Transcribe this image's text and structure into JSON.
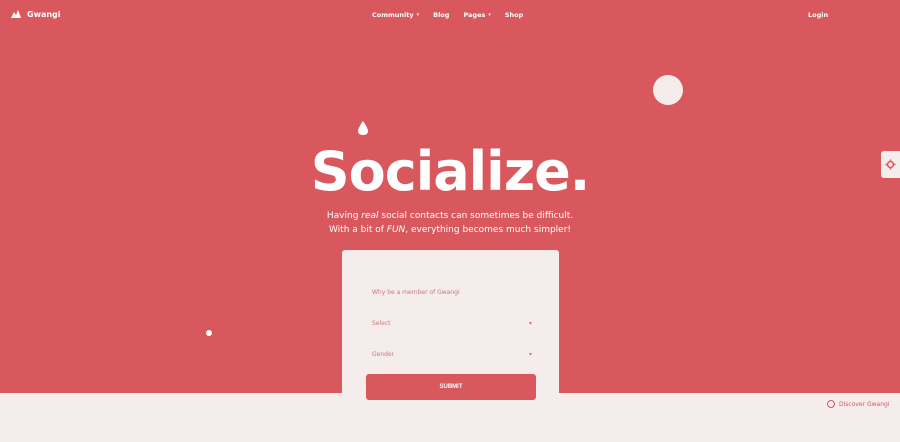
{
  "brand": {
    "name": "Gwangi"
  },
  "nav": {
    "items": [
      {
        "label": "Community",
        "dropdown": true
      },
      {
        "label": "Blog",
        "dropdown": false
      },
      {
        "label": "Pages",
        "dropdown": true
      },
      {
        "label": "Shop",
        "dropdown": false
      }
    ],
    "login": "Login"
  },
  "hero": {
    "title": "Socialize.",
    "subtitle_line1_pre": "Having ",
    "subtitle_line1_em": "real",
    "subtitle_line1_post": " social contacts can sometimes be difficult.",
    "subtitle_line2_pre": "With a bit of ",
    "subtitle_line2_em": "FUN",
    "subtitle_line2_post": ", everything becomes much simpler!"
  },
  "form": {
    "field1": "Why be a member of Gwangi",
    "field2": "Select",
    "field3": "Gender",
    "submit": "SUBMIT"
  },
  "footer": {
    "discover": "Discover Gwangi"
  },
  "colors": {
    "primary": "#d9585e",
    "light": "#f5ecec"
  }
}
